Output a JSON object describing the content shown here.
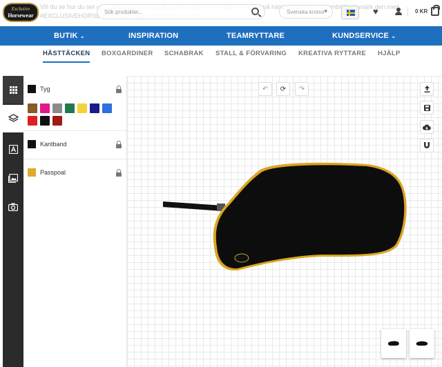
{
  "banner_text": "Vill du se hur du ser ut? Ladda upp en bild på sociala medier, eller gör en design på hästen och ta en skärmbild och märk den med #EXCLUSIVEHORSEWEAR eller gärna \"DESIGNA SJÄLV\"",
  "logo": {
    "line1": "Exclusive",
    "line2": "Horsewear"
  },
  "search": {
    "placeholder": "Sök produkter..."
  },
  "currency": {
    "selected": "Svenska kronor"
  },
  "cart": {
    "label": "0 KR"
  },
  "main_nav": [
    {
      "label": "BUTIK",
      "has_dropdown": true
    },
    {
      "label": "INSPIRATION",
      "has_dropdown": false
    },
    {
      "label": "TEAMRYTTARE",
      "has_dropdown": false
    },
    {
      "label": "KUNDSERVICE",
      "has_dropdown": true
    }
  ],
  "sub_nav": [
    {
      "label": "HÄSTTÄCKEN",
      "active": true
    },
    {
      "label": "BOXGARDINER",
      "active": false
    },
    {
      "label": "SCHABRAK",
      "active": false
    },
    {
      "label": "STALL & FÖRVARING",
      "active": false
    },
    {
      "label": "KREATIVA RYTTARE",
      "active": false
    },
    {
      "label": "HJÄLP",
      "active": false
    }
  ],
  "sidebar_tools": [
    {
      "icon": "grid-icon",
      "active": false
    },
    {
      "icon": "layers-icon",
      "active": true
    },
    {
      "icon": "text-icon",
      "active": false
    },
    {
      "icon": "image-icon",
      "active": false
    },
    {
      "icon": "camera-icon",
      "active": false
    }
  ],
  "layers": [
    {
      "label": "Tyg",
      "color": "#111111",
      "locked": true
    },
    {
      "label": "Kantband",
      "color": "#111111",
      "locked": true
    },
    {
      "label": "Passpoal",
      "color": "#e0a82e",
      "locked": true
    }
  ],
  "palette": [
    "#8a5a2b",
    "#e0198c",
    "#8c8c8c",
    "#1f7a4f",
    "#f5d23a",
    "#1a1a8c",
    "#2f6fe0",
    "#e02020",
    "#111111",
    "#a01818"
  ],
  "canvas_tools": [
    {
      "icon": "undo-icon"
    },
    {
      "icon": "reset-icon"
    },
    {
      "icon": "redo-icon"
    }
  ],
  "right_tools": [
    {
      "icon": "upload-icon"
    },
    {
      "icon": "save-icon"
    },
    {
      "icon": "cloud-download-icon"
    },
    {
      "icon": "magnet-icon"
    }
  ],
  "product": {
    "rug_color": "#0d0d0d",
    "piping_color": "#d9a520",
    "binding_color": "#111111"
  }
}
